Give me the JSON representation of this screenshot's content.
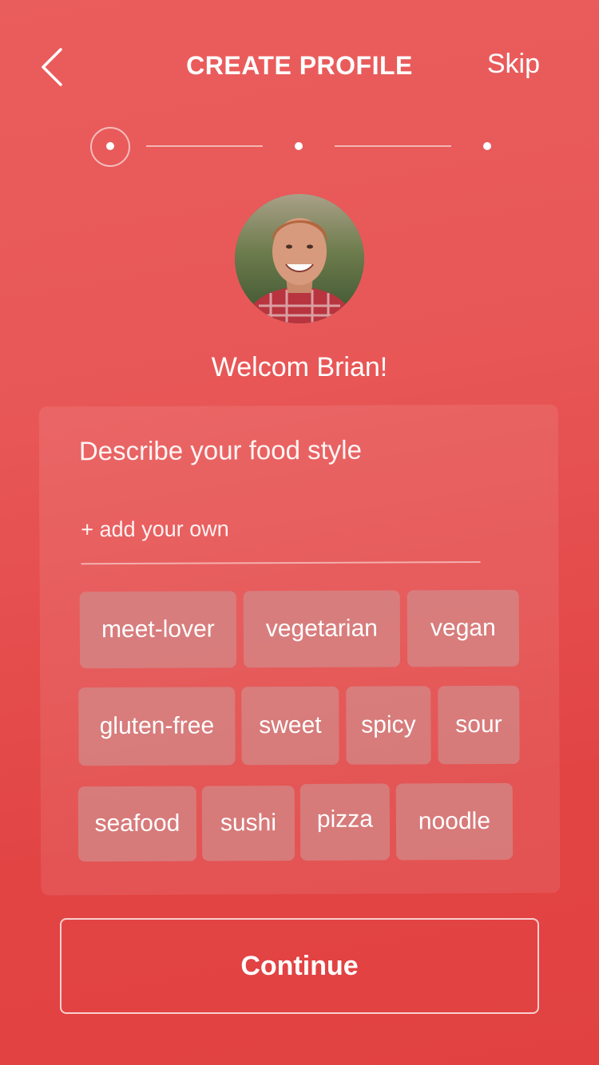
{
  "header": {
    "title": "CREATE PROFILE",
    "skip_label": "Skip",
    "back_icon": "chevron-left-icon"
  },
  "stepper": {
    "total_steps": 3,
    "current_step": 1
  },
  "profile": {
    "welcome_text": "Welcom Brian!"
  },
  "food_style": {
    "heading": "Describe your food style",
    "add_placeholder": "+ add your own",
    "tags": [
      "meet-lover",
      "vegetarian",
      "vegan",
      "gluten-free",
      "sweet",
      "spicy",
      "sour",
      "seafood",
      "sushi",
      "pizza",
      "noodle"
    ]
  },
  "footer": {
    "continue_label": "Continue"
  },
  "colors": {
    "background_top": "#ea5d5d",
    "background_bottom": "#e14141",
    "text": "#ffffff"
  }
}
